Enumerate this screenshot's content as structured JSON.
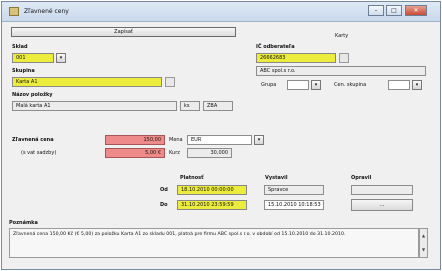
{
  "window": {
    "title": "Zľavnené ceny",
    "minimize": "–",
    "maximize": "□",
    "close": "✕"
  },
  "toolbar": {
    "save_label": "Zapísať"
  },
  "tab": {
    "label": "Karty"
  },
  "form": {
    "sklad": {
      "label": "Sklad",
      "value": "001",
      "dropdown": "▾"
    },
    "skupina_zakazok": {
      "label": "Skupina",
      "value": "Karta A1"
    },
    "nazov": {
      "label": "Názov položky",
      "value": "Malá karta A1",
      "unit": "ks",
      "currency": "ZBA"
    },
    "odberatel": {
      "label": "IČ odberateľa",
      "value": "26662683",
      "name": "ABC spol.s r.o."
    },
    "grupa": {
      "label": "Grupa",
      "dropdown": "▾"
    },
    "cen_skupina": {
      "label": "Cen. skupina",
      "dropdown": "▾"
    },
    "zlavnena_cena": {
      "label": "Zľavnená cena",
      "value": "150,00"
    },
    "s_vat": {
      "label": "(s vat sadzby)",
      "value": "5,00 €"
    },
    "mena": {
      "label": "Mena",
      "value": "EUR",
      "dropdown": "▾"
    },
    "kurz": {
      "label": "Kurz",
      "value": "30,000"
    },
    "platnost": {
      "label": "Platnosť",
      "od_label": "Od",
      "od_value": "18.10.2010 00:00:00",
      "do_label": "Do",
      "do_value": "31.10.2010 23:59:59"
    },
    "vystavil": {
      "label": "Vystavil",
      "name": "Spravce",
      "date": "15.10.2010 10:18:53"
    },
    "opravil": {
      "label": "Opravil",
      "button": "..."
    }
  },
  "poznamka": {
    "label": "Poznámka",
    "text": "Zľavnená cena 150,00 Kč (€ 5,00) za položku Karta A1 zo skladu 001, platná pre firmu ABC spol.s r.o. v období od 15.10.2010 do 31.10.2010.",
    "scroll_up": "▲",
    "scroll_down": "▼"
  }
}
